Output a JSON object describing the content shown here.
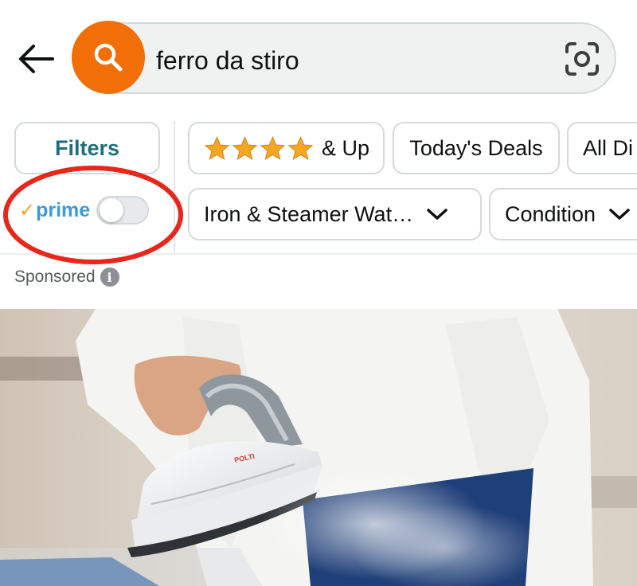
{
  "search": {
    "query": "ferro da stiro"
  },
  "filters": {
    "filters_label": "Filters",
    "stars_label": "& Up",
    "stars_count": 4,
    "deals_label": "Today's Deals",
    "all_dept_label": "All Di",
    "iron_label": "Iron & Steamer Wat…",
    "condition_label": "Condition"
  },
  "prime": {
    "check": "✓",
    "label": "prime",
    "enabled": false
  },
  "sponsored": {
    "label": "Sponsored",
    "info": "i"
  },
  "product": {
    "brand_text": "POLTI"
  },
  "colors": {
    "search_button": "#f26e06",
    "filters_text": "#1f6e7f",
    "star": "#f5a623",
    "prime_blue": "#3b9ad9",
    "annotation_circle": "#e8271b"
  }
}
